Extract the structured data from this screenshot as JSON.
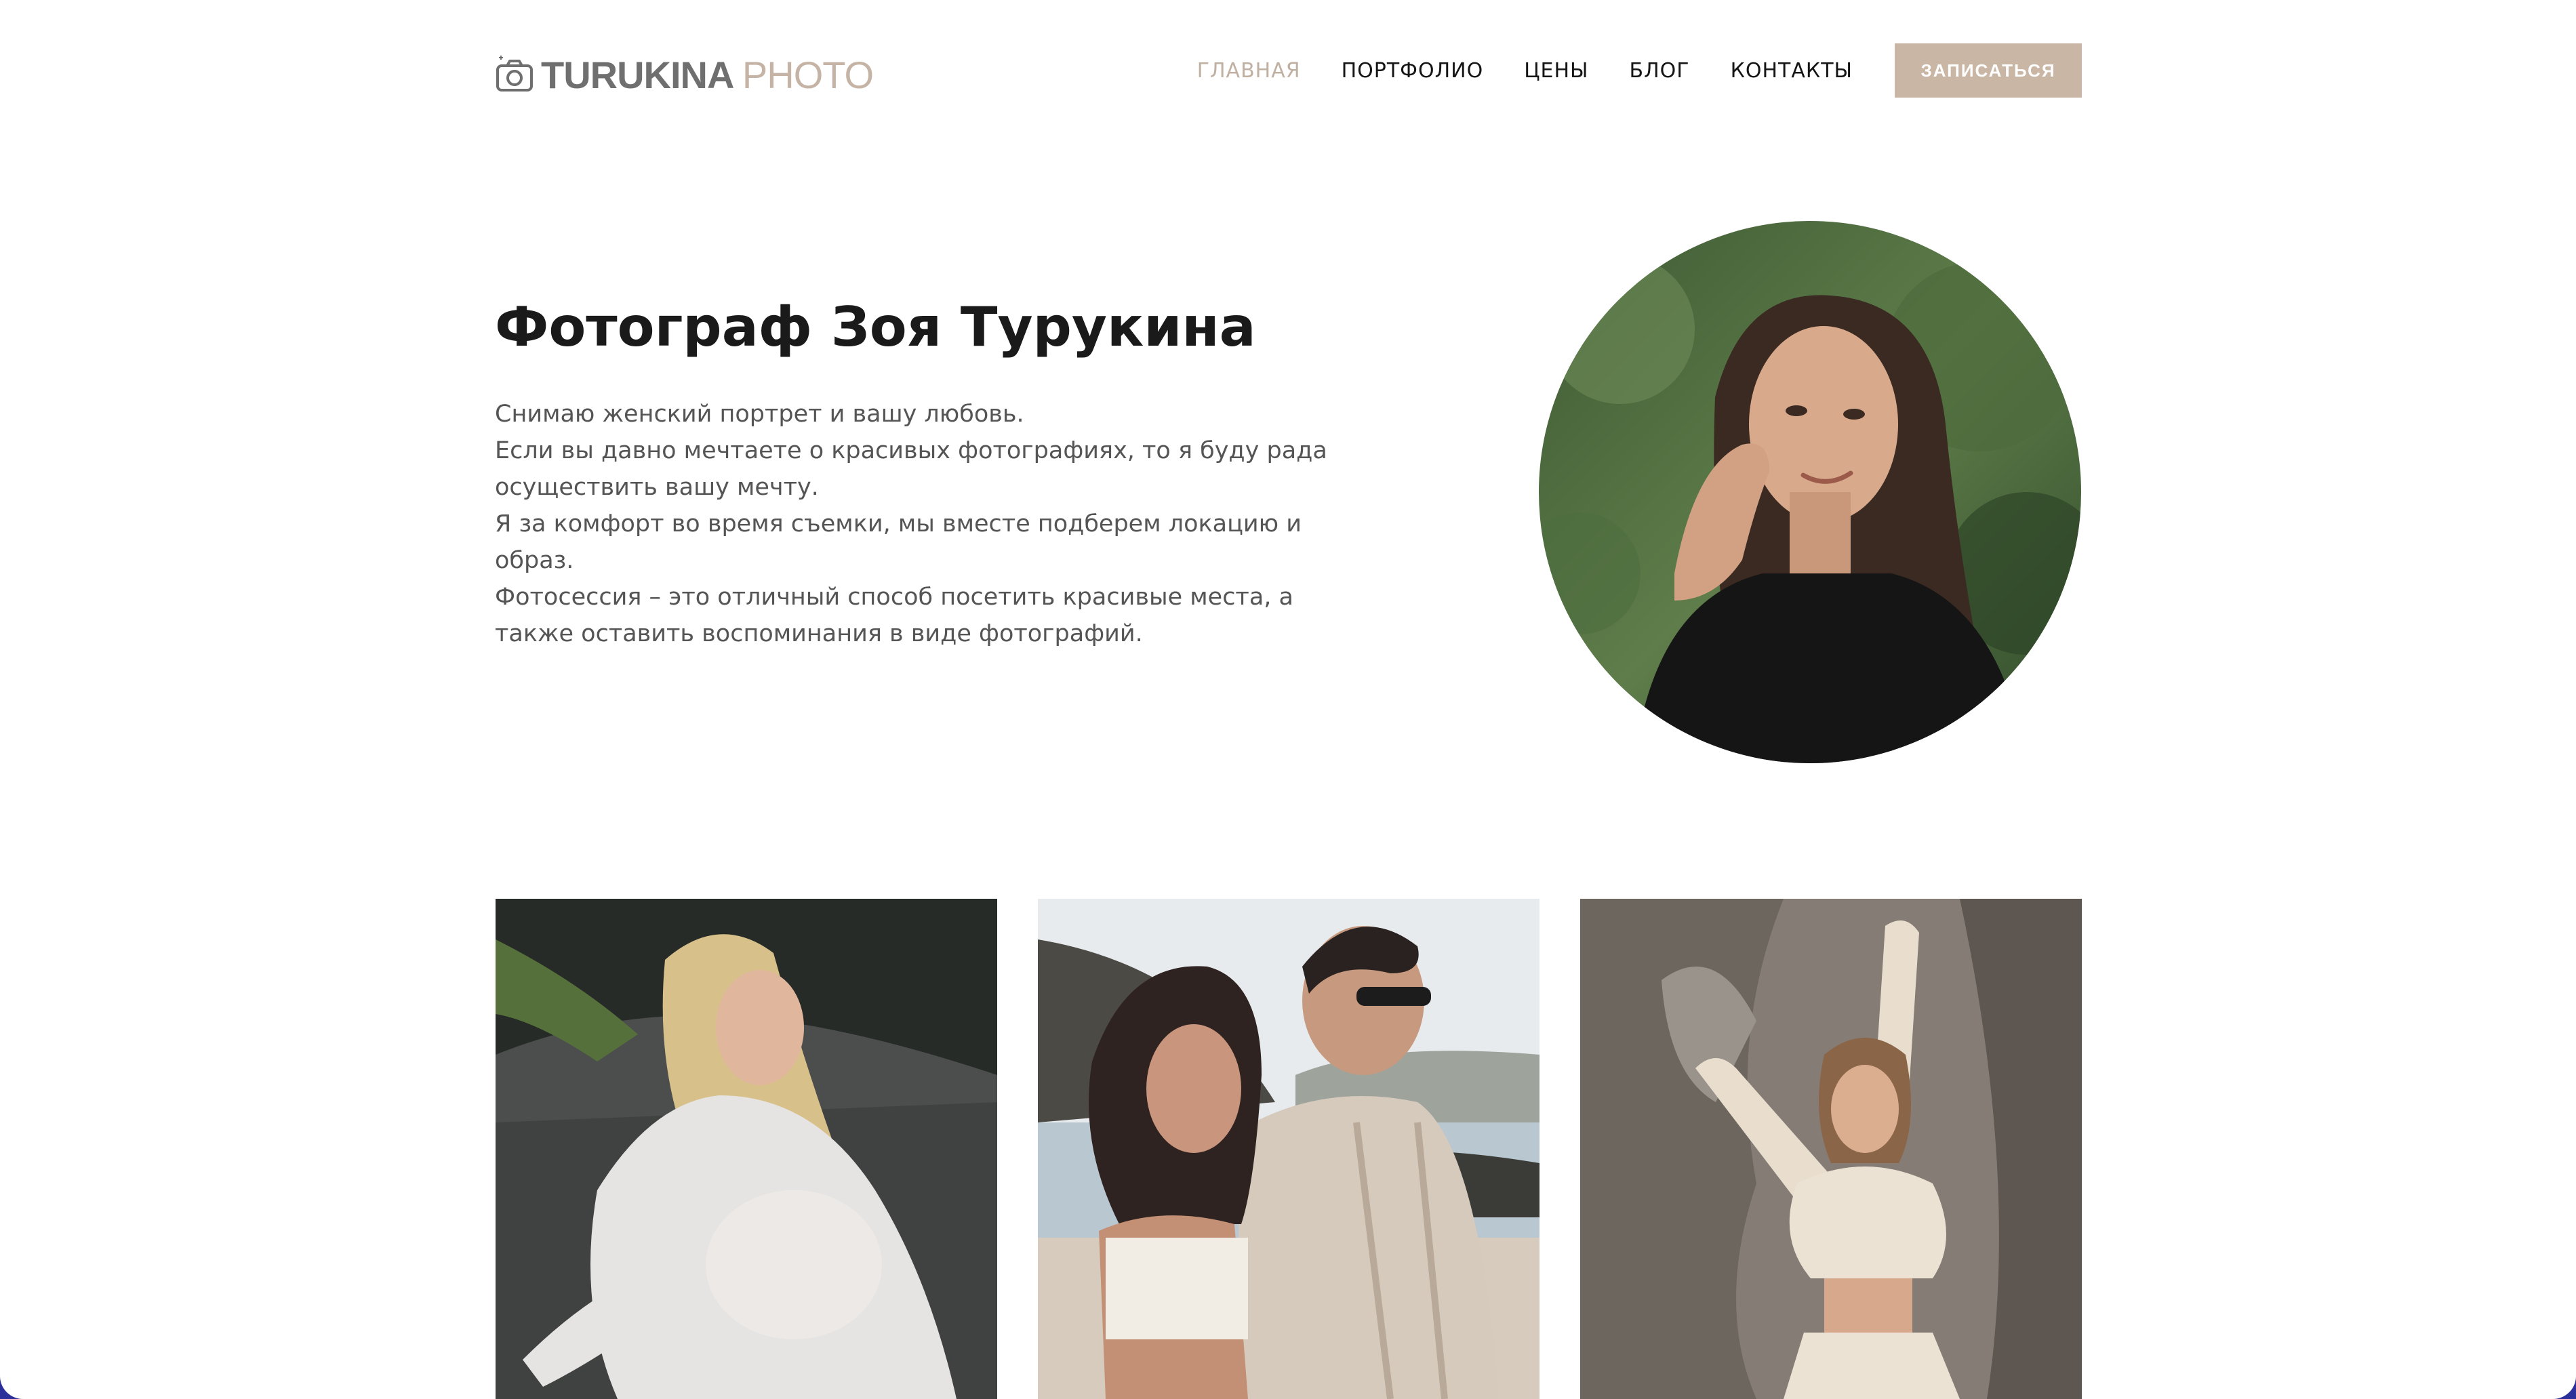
{
  "header": {
    "logo": {
      "icon": "camera-icon",
      "brand": "TURUKINA",
      "brand_accent": "PHOTO"
    },
    "nav": [
      {
        "label": "ГЛАВНАЯ",
        "active": true
      },
      {
        "label": "ПОРТФОЛИО",
        "active": false
      },
      {
        "label": "ЦЕНЫ",
        "active": false
      },
      {
        "label": "БЛОГ",
        "active": false
      },
      {
        "label": "КОНТАКТЫ",
        "active": false
      }
    ],
    "cta_label": "ЗАПИСАТЬСЯ"
  },
  "hero": {
    "title": "Фотограф Зоя Турукина",
    "paragraphs": [
      "Снимаю женский портрет и вашу любовь.",
      "Если вы давно мечтаете о красивых фотографиях, то я буду рада осуществить вашу мечту.",
      "Я за комфорт во время съемки, мы вместе подберем локацию и образ.",
      "Фотосессия – это отличный способ посетить красивые места, а также оставить воспоминания в виде фотографий."
    ]
  },
  "colors": {
    "accent": "#cab6a4",
    "nav_active": "#bfb0a2",
    "text_dark": "#1a1a1a",
    "text_body": "#555555",
    "logo_gray": "#6f6f6f",
    "frame_background": "#2a2f9a"
  }
}
